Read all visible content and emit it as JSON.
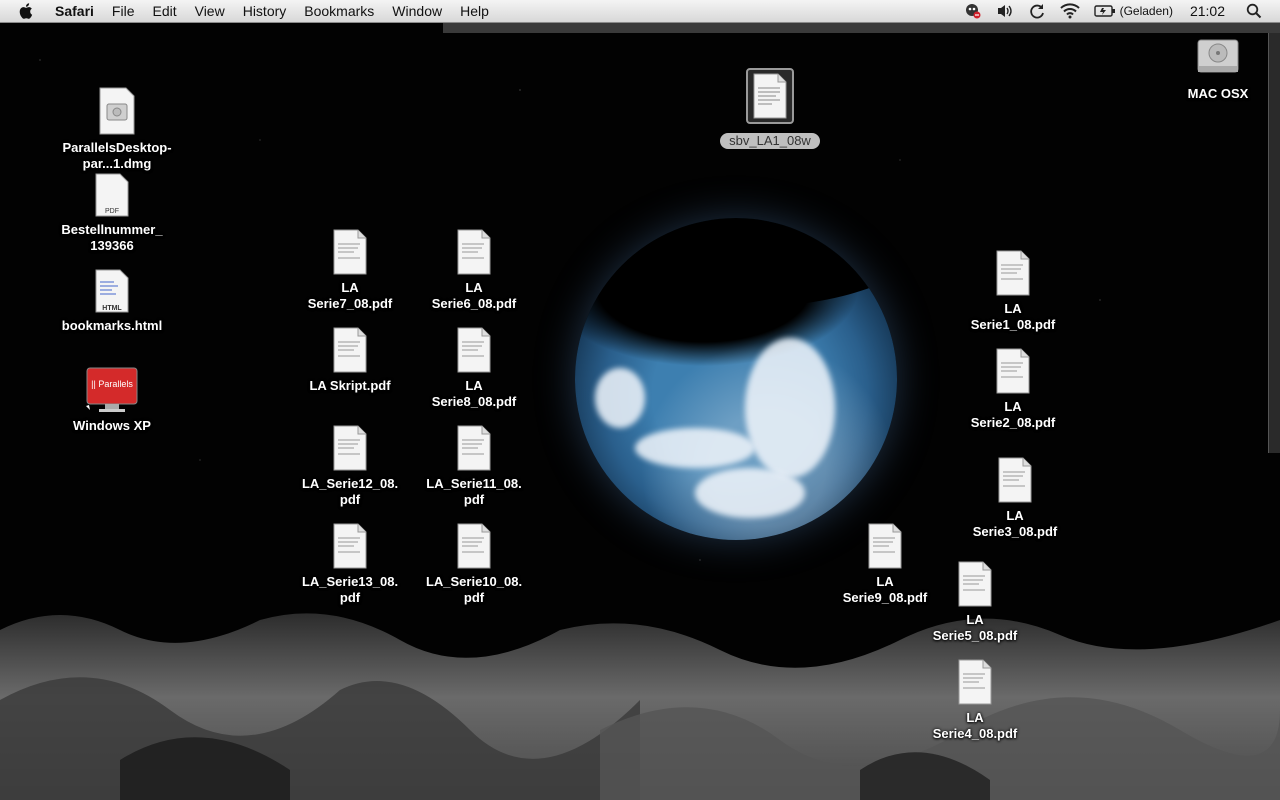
{
  "menubar": {
    "app_name": "Safari",
    "items": [
      "File",
      "Edit",
      "View",
      "History",
      "Bookmarks",
      "Window",
      "Help"
    ],
    "battery_text": "(Geladen)",
    "clock": "21:02"
  },
  "desktop": {
    "selected_file": "sbv_LA1_08w",
    "disk": "MAC OSX",
    "left_column": {
      "dmg": "ParallelsDesktop-par...1.dmg",
      "pdf_order": "Bestellnummer_ 139366",
      "html": "bookmarks.html",
      "winxp": "Windows XP"
    },
    "files": {
      "serie7": "LA\nSerie7_08.pdf",
      "serie6": "LA\nSerie6_08.pdf",
      "skript": "LA Skript.pdf",
      "serie8": "LA\nSerie8_08.pdf",
      "serie12": "LA_Serie12_08.\npdf",
      "serie11": "LA_Serie11_08.\npdf",
      "serie13": "LA_Serie13_08.\npdf",
      "serie10": "LA_Serie10_08.\npdf",
      "serie1": "LA\nSerie1_08.pdf",
      "serie2": "LA\nSerie2_08.pdf",
      "serie3": "LA\nSerie3_08.pdf",
      "serie9": "LA\nSerie9_08.pdf",
      "serie5": "LA\nSerie5_08.pdf",
      "serie4": "LA\nSerie4_08.pdf"
    },
    "badges": {
      "pdf": "PDF",
      "html": "HTML",
      "parallels": "|| Parallels"
    }
  },
  "colors": {
    "menubar_top": "#f4f4f4",
    "menubar_bottom": "#d8d8d8",
    "label_text": "#ffffff",
    "selected_label_bg": "#bfbfbf"
  }
}
